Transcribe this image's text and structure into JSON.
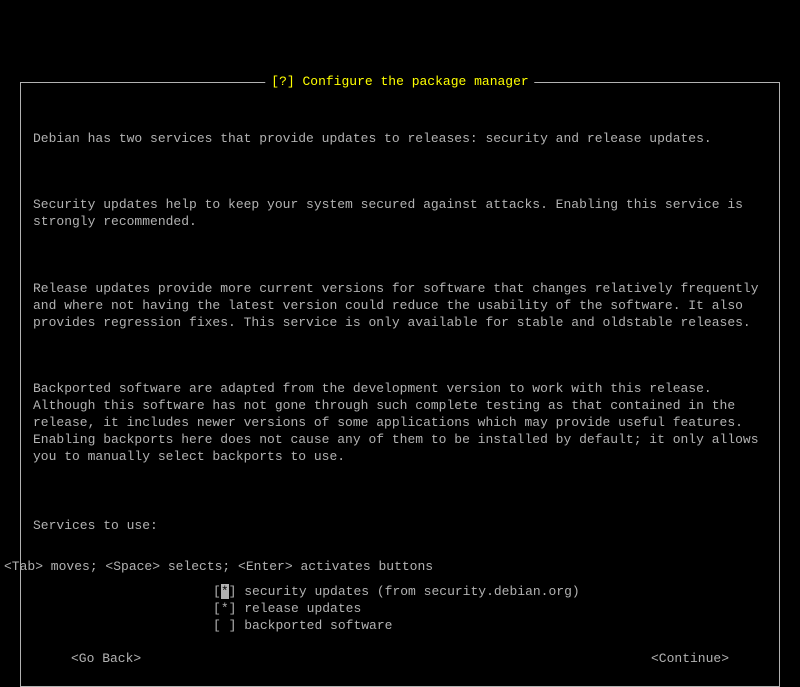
{
  "dialog": {
    "title": "[?] Configure the package manager",
    "paragraphs": [
      "Debian has two services that provide updates to releases: security and release updates.",
      "Security updates help to keep your system secured against attacks. Enabling this service is strongly recommended.",
      "Release updates provide more current versions for software that changes relatively frequently and where not having the latest version could reduce the usability of the software. It also provides regression fixes. This service is only available for stable and oldstable releases.",
      "Backported software are adapted from the development version to work with this release. Although this software has not gone through such complete testing as that contained in the release, it includes newer versions of some applications which may provide useful features. Enabling backports here does not cause any of them to be installed by default; it only allows you to manually select backports to use."
    ],
    "prompt": "Services to use:",
    "options": [
      {
        "mark": "*",
        "label": "security updates (from security.debian.org)",
        "highlighted": true
      },
      {
        "mark": "*",
        "label": "release updates",
        "highlighted": false
      },
      {
        "mark": " ",
        "label": "backported software",
        "highlighted": false
      }
    ],
    "buttons": {
      "back": "<Go Back>",
      "continue": "<Continue>"
    }
  },
  "statusbar": "<Tab> moves; <Space> selects; <Enter> activates buttons"
}
